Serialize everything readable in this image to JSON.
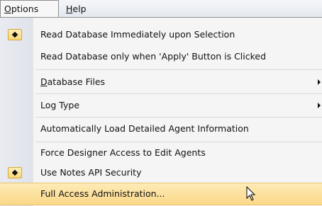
{
  "menubar": {
    "options": {
      "prefix": "",
      "accel": "O",
      "rest": "ptions"
    },
    "help": {
      "accel": "H",
      "rest": "elp"
    }
  },
  "menu": {
    "items": [
      {
        "label": "Read Database Immediately upon Selection",
        "checked": true
      },
      {
        "label": "Read Database only when 'Apply' Button is Clicked",
        "checked": false
      },
      {
        "accel": "D",
        "rest": "atabase Files",
        "submenu": true
      },
      {
        "label": "Log Type",
        "submenu": true
      },
      {
        "label": "Automatically Load Detailed Agent Information"
      },
      {
        "label": "Force Designer Access to Edit Agents"
      },
      {
        "label": "Use Notes API Security",
        "checked": true
      },
      {
        "label": "Full Access Administration...",
        "highlighted": true
      }
    ]
  },
  "colors": {
    "highlight": "#fbd889",
    "check_bg": "#f9d878"
  },
  "icons": [
    "bullet-check-icon",
    "submenu-arrow-icon",
    "mouse-pointer-icon"
  ]
}
